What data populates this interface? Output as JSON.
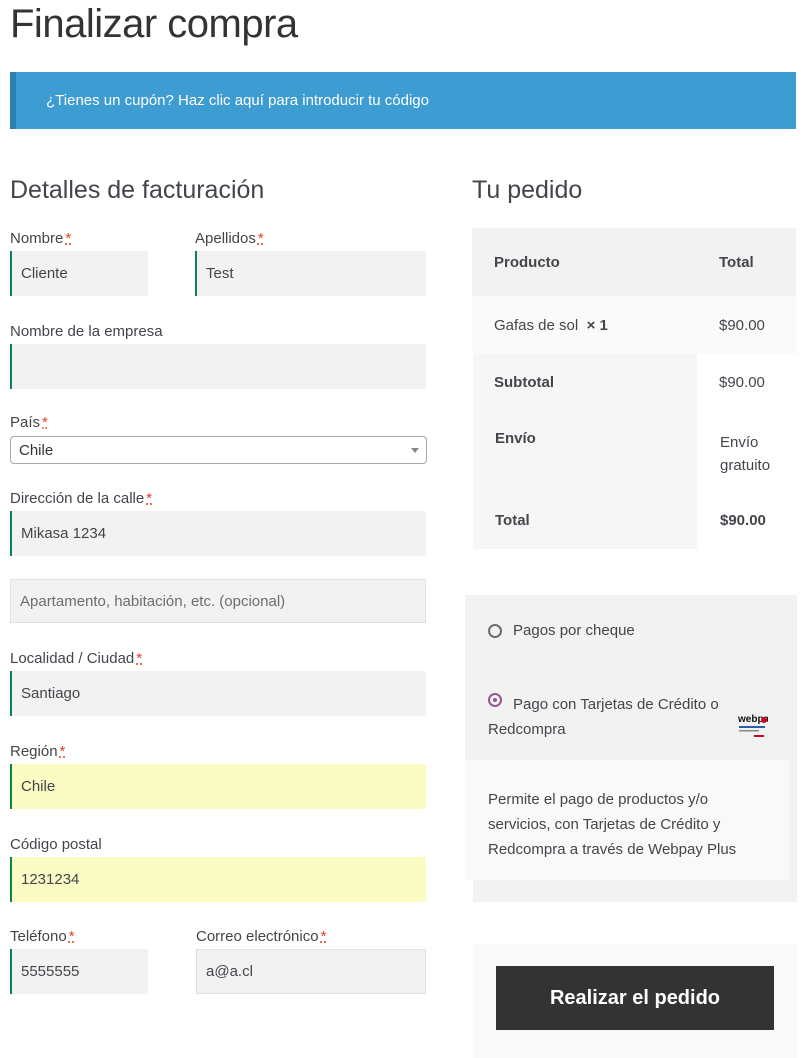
{
  "page": {
    "title": "Finalizar compra"
  },
  "coupon": {
    "text": "¿Tienes un cupón? Haz clic aquí para introducir tu código"
  },
  "billing": {
    "heading": "Detalles de facturación",
    "required_mark": "*",
    "first_name": {
      "label": "Nombre",
      "value": "Cliente"
    },
    "last_name": {
      "label": "Apellidos",
      "value": "Test"
    },
    "company": {
      "label": "Nombre de la empresa",
      "value": ""
    },
    "country": {
      "label": "País",
      "value": "Chile"
    },
    "address_1": {
      "label": "Dirección de la calle",
      "value": "Mikasa 1234"
    },
    "address_2": {
      "placeholder": "Apartamento, habitación, etc. (opcional)"
    },
    "city": {
      "label": "Localidad / Ciudad",
      "value": "Santiago"
    },
    "state": {
      "label": "Región",
      "value": "Chile"
    },
    "postcode": {
      "label": "Código postal",
      "value": "1231234"
    },
    "phone": {
      "label": "Teléfono",
      "value": "5555555"
    },
    "email": {
      "label": "Correo electrónico",
      "value": "a@a.cl"
    }
  },
  "order": {
    "heading": "Tu pedido",
    "col_product": "Producto",
    "col_total": "Total",
    "item_name": "Gafas de sol",
    "item_qty": "× 1",
    "item_total": "$90.00",
    "subtotal_label": "Subtotal",
    "subtotal_value": "$90.00",
    "shipping_label": "Envío",
    "shipping_value_line1": "Envío",
    "shipping_value_line2": "gratuito",
    "total_label": "Total",
    "total_value": "$90.00"
  },
  "payment": {
    "cheque_label": "Pagos por cheque",
    "card_label_line1": "Pago con Tarjetas de Crédito o",
    "card_label_line2": "Redcompra",
    "logo_text": "webpay",
    "description_line1": "Permite el pago de productos y/o",
    "description_line2": "servicios, con Tarjetas de Crédito y",
    "description_line3": "Redcompra a través de Webpay Plus"
  },
  "place_order": {
    "label": "Realizar el pedido"
  }
}
